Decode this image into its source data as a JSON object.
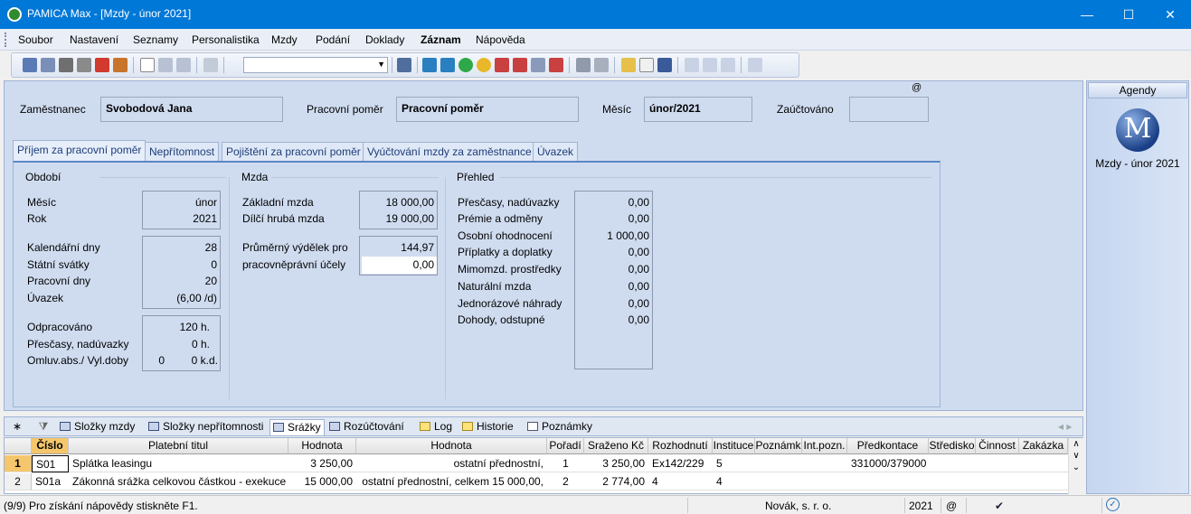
{
  "window": {
    "title": "PAMICA Max - [Mzdy - únor 2021]",
    "minimize": "—",
    "maximize": "☐",
    "close": "✕"
  },
  "menu": [
    "Soubor",
    "Nastavení",
    "Seznamy",
    "Personalistika",
    "Mzdy",
    "Podání",
    "Doklady",
    "Záznam",
    "Nápověda"
  ],
  "toolbar": {
    "combo_value": ""
  },
  "header": {
    "employee_label": "Zaměstnanec",
    "employee_value": "Svobodová Jana",
    "relation_label": "Pracovní poměr",
    "relation_value": "Pracovní poměr",
    "month_label": "Měsíc",
    "month_value": "únor/2021",
    "posted_label": "Zaúčtováno",
    "posted_value": "",
    "at_sign": "@"
  },
  "tabs": [
    "Příjem za pracovní poměr",
    "Nepřítomnost",
    "Pojištění za pracovní poměr",
    "Vyúčtování mzdy za zaměstnance",
    "Úvazek"
  ],
  "obdobi": {
    "title": "Období",
    "mesic_label": "Měsíc",
    "mesic_value": "únor",
    "rok_label": "Rok",
    "rok_value": "2021",
    "kal_label": "Kalendářní dny",
    "kal_value": "28",
    "svatky_label": "Státní svátky",
    "svatky_value": "0",
    "prac_label": "Pracovní dny",
    "prac_value": "20",
    "uvazek_label": "Úvazek",
    "uvazek_value": "(6,00 /d)",
    "odprac_label": "Odpracováno",
    "odprac_value": "120 h.",
    "prescasy_label": "Přesčasy, nadúvazky",
    "prescasy_value": "0 h.",
    "omluv_label": "Omluv.abs./ Vyl.doby",
    "omluv_value1": "0",
    "omluv_value2": "0 k.d."
  },
  "mzda": {
    "title": "Mzda",
    "zakladni_label": "Základní mzda",
    "zakladni_value": "18 000,00",
    "dilci_label": "Dílčí hrubá mzda",
    "dilci_value": "19 000,00",
    "prumer_label1": "Průměrný výdělek pro",
    "prumer_label2": "pracovněprávní účely",
    "prumer_value": "144,97",
    "prumer_input": "0,00"
  },
  "prehled": {
    "title": "Přehled",
    "rows": [
      {
        "label": "Přesčasy, nadúvazky",
        "value": "0,00"
      },
      {
        "label": "Prémie a odměny",
        "value": "0,00"
      },
      {
        "label": "Osobní ohodnocení",
        "value": "1 000,00"
      },
      {
        "label": "Příplatky a doplatky",
        "value": "0,00"
      },
      {
        "label": "Mimomzd. prostředky",
        "value": "0,00"
      },
      {
        "label": "Naturální mzda",
        "value": "0,00"
      },
      {
        "label": "Jednorázové náhrady",
        "value": "0,00"
      },
      {
        "label": "Dohody, odstupné",
        "value": "0,00"
      }
    ]
  },
  "sidebar": {
    "header": "Agendy",
    "logo_letter": "M",
    "caption": "Mzdy - únor 2021"
  },
  "bottom_tabs": [
    "Složky mzdy",
    "Složky nepřítomnosti",
    "Srážky",
    "Rozúčtování",
    "Log",
    "Historie",
    "Poznámky"
  ],
  "grid": {
    "headers": [
      "Číslo",
      "Platební titul",
      "Hodnota",
      "Hodnota",
      "Pořadí",
      "Sraženo Kč",
      "Rozhodnutí",
      "Instituce",
      "Poznámk",
      "Int.pozn.",
      "Předkontace",
      "Středisko",
      "Činnost",
      "Zakázka"
    ],
    "rows": [
      {
        "n": "1",
        "cislo": "S01",
        "titul": "Splátka leasingu",
        "hodnota": "3 250,00",
        "hodnota2": "ostatní přednostní,",
        "poradi": "1",
        "srazeno": "3 250,00",
        "rozhodnuti": "Ex142/229",
        "instituce": "5",
        "pozn": "",
        "intpozn": "",
        "predkontace": "331000/379000",
        "stredisko": "",
        "cinnost": "",
        "zakazka": ""
      },
      {
        "n": "2",
        "cislo": "S01a",
        "titul": "Zákonná srážka celkovou částkou - exekuce",
        "hodnota": "15 000,00",
        "hodnota2": "ostatní přednostní, celkem 15 000,00,",
        "poradi": "2",
        "srazeno": "2 774,00",
        "rozhodnuti": "4",
        "instituce": "4",
        "pozn": "",
        "intpozn": "",
        "predkontace": "",
        "stredisko": "",
        "cinnost": "",
        "zakazka": ""
      }
    ]
  },
  "status": {
    "help": "(9/9) Pro získání nápovědy stiskněte F1.",
    "company": "Novák, s. r. o.",
    "year": "2021",
    "at": "@"
  }
}
